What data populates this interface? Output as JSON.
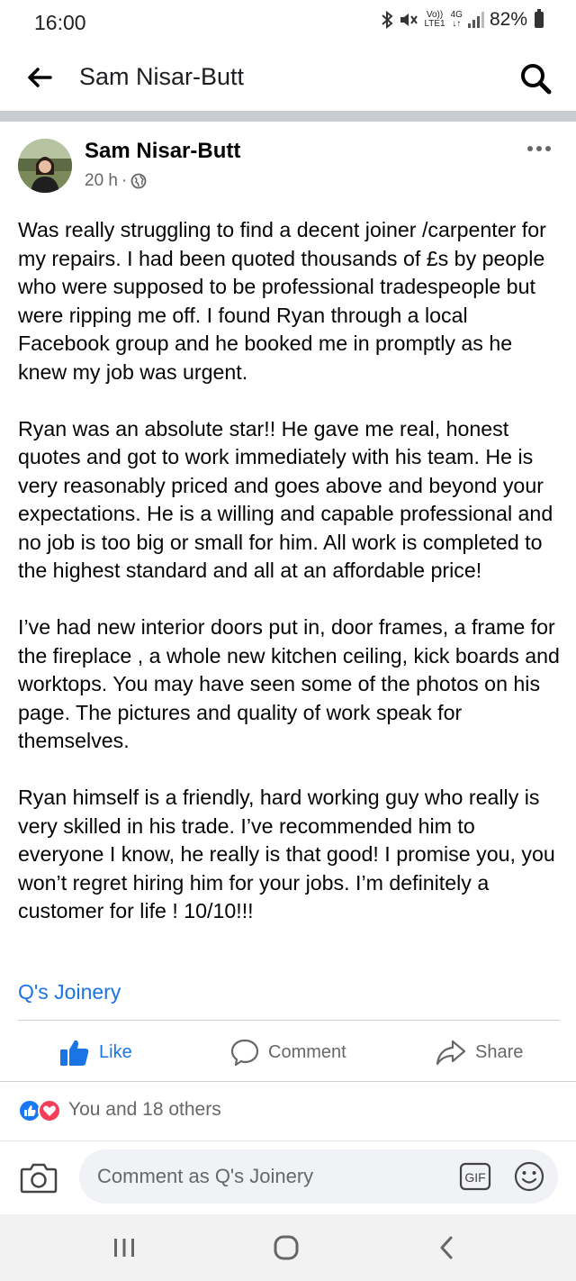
{
  "status_bar": {
    "time": "16:00",
    "volte_label": "Vo))",
    "lte_label": "LTE1",
    "network_label": "4G",
    "battery_text": "82%"
  },
  "header": {
    "title": "Sam Nisar-Butt",
    "icons": [
      "back-arrow-icon",
      "search-icon"
    ]
  },
  "post": {
    "author": "Sam Nisar-Butt",
    "time_ago": "20 h",
    "separator": "·",
    "paragraphs": [
      "Was really struggling to find a decent joiner /carpenter for my repairs.  I had been quoted thousands of £s by people who were supposed to be professional tradespeople but were ripping me off. I found Ryan through a local Facebook group and he booked me in promptly as he knew my job was urgent.",
      "Ryan was an absolute star!! He gave me real, honest quotes and got to work immediately with his team. He is very reasonably priced and goes above and beyond your expectations. He is a willing and capable professional and no job is too big or small for him. All work is completed to the  highest standard and all at an affordable price!",
      "I’ve had new interior doors put in, door frames, a frame for the fireplace , a whole new kitchen ceiling, kick boards and  worktops. You may have seen some of the photos on his page. The pictures and quality of work speak for themselves.",
      "Ryan himself is a friendly, hard working guy who really is very skilled in his trade.  I’ve recommended him to everyone I know, he really is that good! I promise you, you won’t regret hiring him for your jobs. I’m definitely a customer for life ! 10/10!!!"
    ],
    "page_link": "Q's Joinery"
  },
  "actions": {
    "like_label": "Like",
    "comment_label": "Comment",
    "share_label": "Share"
  },
  "reactions": {
    "summary": "You and 18 others",
    "types": [
      "like",
      "love"
    ]
  },
  "comment_bar": {
    "placeholder": "Comment as Q's Joinery",
    "gif_label": "GIF"
  },
  "colors": {
    "facebook_blue": "#1b74e4",
    "love_red": "#f33e58",
    "divider_gray": "#c9ccd1",
    "secondary_text": "#65676b"
  }
}
